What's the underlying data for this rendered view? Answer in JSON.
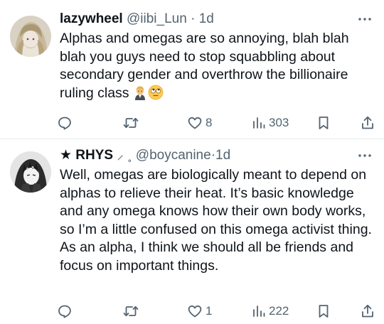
{
  "tweets": [
    {
      "display_name": "lazywheel",
      "handle": "@iibi_Lun",
      "separator": "·",
      "time": "1d",
      "text": "Alphas and omegas are so annoying,  blah blah blah you guys need to stop squabbling about secondary gender and overthrow the billionaire ruling class",
      "emoji_icons": [
        "man-judge-emoji",
        "eye-roll-emoji"
      ],
      "likes": "8",
      "views": "303"
    },
    {
      "display_name": "★ RHYS",
      "name_suffix": "⸝ ˳",
      "handle": "@boycanine",
      "separator": "·",
      "time": "1d",
      "text": "Well, omegas are biologically meant to depend on alphas to relieve their heat. It’s basic knowledge and any omega knows how their own body works, so I’m a little confused on this omega activist thing. As an alpha, I think we should all be friends and focus on important things.",
      "likes": "1",
      "views": "222"
    }
  ],
  "icons": {
    "reply": "reply-bubble-icon",
    "retweet": "retweet-icon",
    "like": "heart-icon",
    "views": "views-bar-icon",
    "bookmark": "bookmark-icon",
    "share": "share-icon",
    "more": "more-dots-icon"
  },
  "colors": {
    "text": "#0f1419",
    "secondary": "#536471",
    "divider": "#e6e9ea"
  }
}
